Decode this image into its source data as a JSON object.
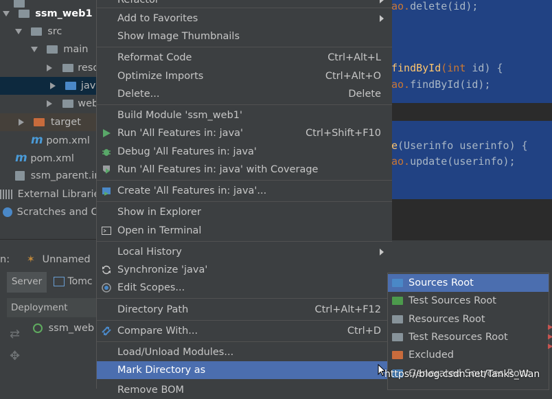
{
  "project_tree": {
    "items": [
      {
        "label": "ssm_web1"
      },
      {
        "label": "src"
      },
      {
        "label": "main"
      },
      {
        "label": "reso"
      },
      {
        "label": "java"
      },
      {
        "label": "web"
      },
      {
        "label": "target"
      },
      {
        "label": "pom.xml"
      },
      {
        "label": "pom.xml"
      },
      {
        "label": "ssm_parent.in"
      },
      {
        "label": "External Librarie"
      },
      {
        "label": "Scratches and Co"
      }
    ]
  },
  "run_panel": {
    "prefix": "n:",
    "config_name": "Unnamed",
    "tabs": [
      "Server",
      "Tomc"
    ],
    "deployment_header": "Deployment",
    "artifact": "ssm_web"
  },
  "editor": {
    "lines": [
      {
        "a": "ao.",
        "b": "delete",
        "c": "(id);"
      },
      {
        "a": "findById",
        "b": "(int",
        "c": " id) {"
      },
      {
        "a": "ao.",
        "b": "findById",
        "c": "(id);"
      },
      {
        "a": "e",
        "b": "(Userinfo userinfo) {",
        "c": ""
      },
      {
        "a": "ao.",
        "b": "update",
        "c": "(userinfo);"
      }
    ]
  },
  "context_menu": {
    "top_partial": "Refactor",
    "items": [
      {
        "label": "Add to Favorites",
        "shortcut": "",
        "submenu": true
      },
      {
        "label": "Show Image Thumbnails",
        "shortcut": ""
      },
      {
        "label": "Reformat Code",
        "shortcut": "Ctrl+Alt+L"
      },
      {
        "label": "Optimize Imports",
        "shortcut": "Ctrl+Alt+O"
      },
      {
        "label": "Delete...",
        "shortcut": "Delete"
      },
      {
        "label": "Build Module 'ssm_web1'",
        "shortcut": ""
      },
      {
        "label": "Run 'All Features in: java'",
        "shortcut": "Ctrl+Shift+F10",
        "icon": "run-icon"
      },
      {
        "label": "Debug 'All Features in: java'",
        "shortcut": "",
        "icon": "debug-icon"
      },
      {
        "label": "Run 'All Features in: java' with Coverage",
        "shortcut": "",
        "icon": "coverage-icon"
      },
      {
        "label": "Create 'All Features in: java'...",
        "shortcut": "",
        "icon": "create-config-icon"
      },
      {
        "label": "Show in Explorer",
        "shortcut": ""
      },
      {
        "label": "Open in Terminal",
        "shortcut": "",
        "icon": "terminal-icon"
      },
      {
        "label": "Local History",
        "shortcut": "",
        "submenu": true
      },
      {
        "label": "Synchronize 'java'",
        "shortcut": "",
        "icon": "sync-icon"
      },
      {
        "label": "Edit Scopes...",
        "shortcut": "",
        "icon": "scope-icon"
      },
      {
        "label": "Directory Path",
        "shortcut": "Ctrl+Alt+F12"
      },
      {
        "label": "Compare With...",
        "shortcut": "Ctrl+D",
        "icon": "compare-icon"
      },
      {
        "label": "Load/Unload Modules...",
        "shortcut": ""
      },
      {
        "label": "Mark Directory as",
        "shortcut": "",
        "submenu": true,
        "highlighted": true
      },
      {
        "label": "Remove BOM",
        "shortcut": ""
      }
    ]
  },
  "submenu": {
    "items": [
      {
        "label": "Sources Root",
        "color": "#4a88c7",
        "highlighted": true
      },
      {
        "label": "Test Sources Root",
        "color": "#4c9a4c"
      },
      {
        "label": "Resources Root",
        "color": "#87939a"
      },
      {
        "label": "Test Resources Root",
        "color": "#87939a"
      },
      {
        "label": "Excluded",
        "color": "#c86b3c"
      },
      {
        "label": "Generated Sources Root",
        "color": "#4a88c7"
      }
    ]
  },
  "watermark": "https://blog.csdn.net/Tanks_Wan",
  "colors": {
    "menu_bg": "#3c3f41",
    "highlight": "#4b6eaf",
    "editor_selection": "#214283"
  }
}
